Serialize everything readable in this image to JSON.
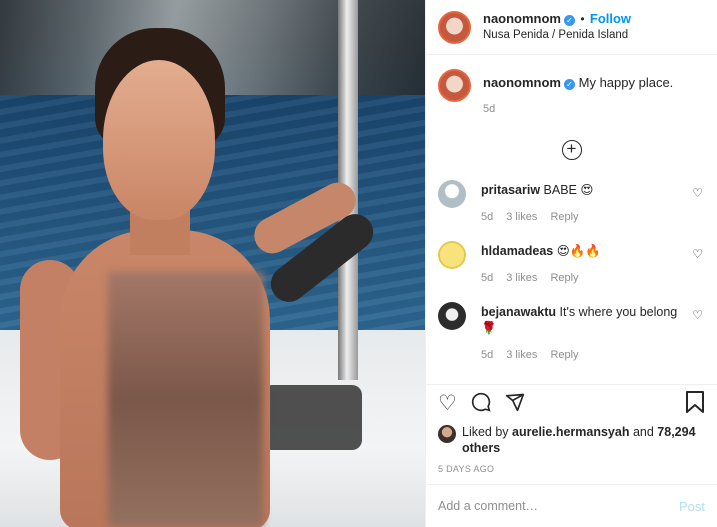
{
  "post": {
    "author": {
      "username": "naonomnom",
      "verified": true,
      "follow_label": "Follow",
      "location": "Nusa Penida / Penida Island"
    },
    "caption": {
      "username": "naonomnom",
      "text": "My happy place.",
      "age": "5d"
    },
    "load_more_icon": "plus-circle-icon",
    "comments": [
      {
        "username": "pritasariw",
        "text": "BABE 😍",
        "age": "5d",
        "likes": "3 likes",
        "reply": "Reply",
        "avatar_color": "#cfd8dc"
      },
      {
        "username": "hldamadeas",
        "text": "😍🔥🔥",
        "age": "5d",
        "likes": "3 likes",
        "reply": "Reply",
        "avatar_color": "#f4e08a"
      },
      {
        "username": "bejanawaktu",
        "text": "It's where you belong 🌹",
        "age": "5d",
        "likes": "3 likes",
        "reply": "Reply",
        "avatar_color": "#333333"
      }
    ],
    "actions": {
      "like_icon": "heart-icon",
      "comment_icon": "comment-icon",
      "share_icon": "paper-plane-icon",
      "save_icon": "bookmark-icon"
    },
    "likes": {
      "prefix": "Liked by",
      "user": "aurelie.hermansyah",
      "joiner": "and",
      "others": "78,294 others"
    },
    "timestamp": "5 DAYS AGO",
    "add_comment": {
      "placeholder": "Add a comment…",
      "post_label": "Post"
    },
    "colors": {
      "link": "#0095f6",
      "muted": "#8e8e8e",
      "post_disabled": "#b2dffc"
    }
  }
}
